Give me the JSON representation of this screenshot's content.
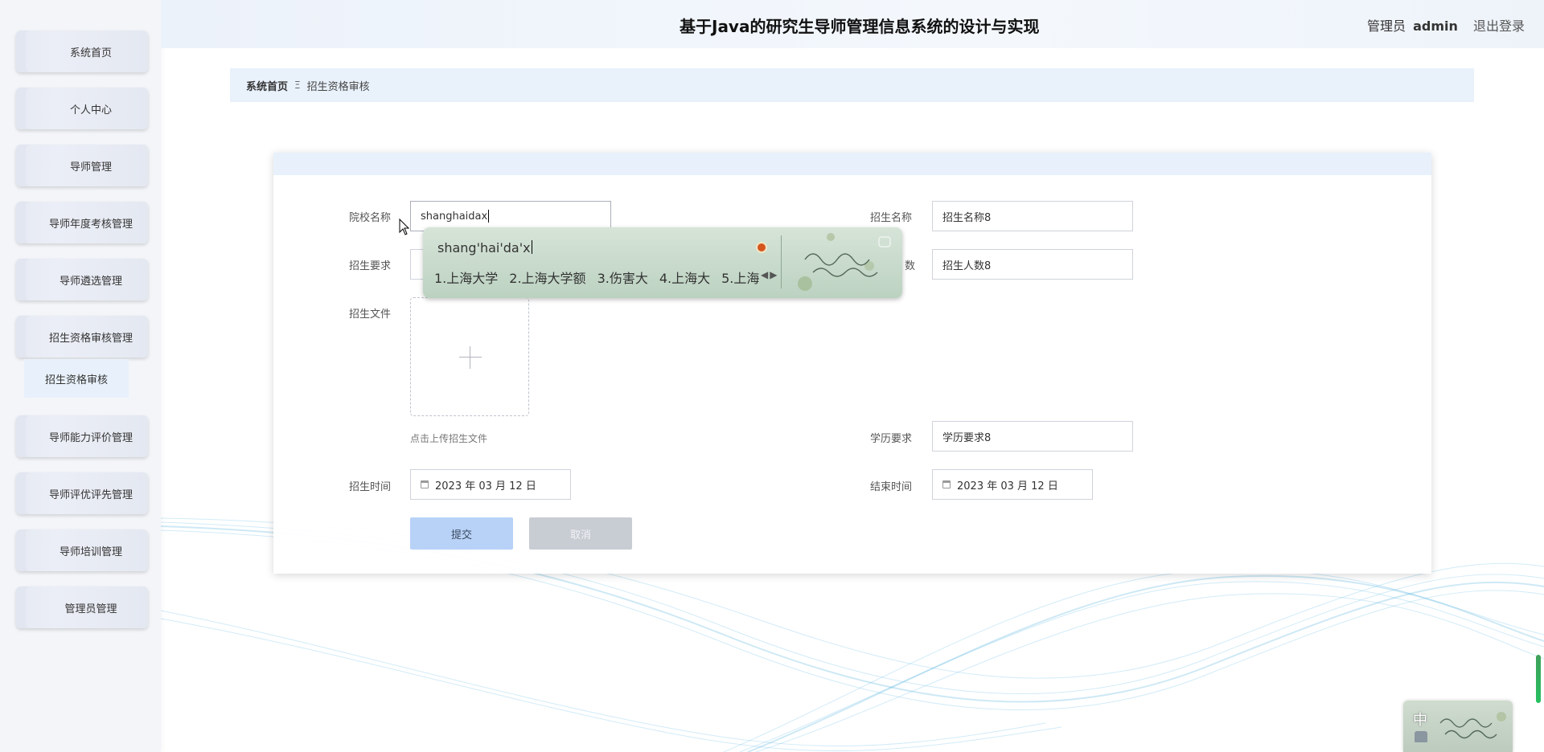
{
  "header": {
    "title": "基于Java的研究生导师管理信息系统的设计与实现",
    "user_role": "管理员",
    "user_name": "admin",
    "logout_label": "退出登录"
  },
  "sidebar": {
    "items": [
      {
        "label": "系统首页"
      },
      {
        "label": "个人中心"
      },
      {
        "label": "导师管理"
      },
      {
        "label": "导师年度考核管理"
      },
      {
        "label": "导师遴选管理"
      },
      {
        "label": "招生资格审核管理"
      },
      {
        "label": "导师能力评价管理"
      },
      {
        "label": "导师评优评先管理"
      },
      {
        "label": "导师培训管理"
      },
      {
        "label": "管理员管理"
      }
    ],
    "submenu": {
      "label": "招生资格审核"
    }
  },
  "breadcrumb": {
    "home": "系统首页",
    "separator": "Ξ",
    "current": "招生资格审核"
  },
  "form": {
    "school_name": {
      "label": "院校名称",
      "value": "shanghaidax"
    },
    "enroll_name": {
      "label": "招生名称",
      "value": "招生名称8"
    },
    "enroll_requirement": {
      "label": "招生要求",
      "value": ""
    },
    "enroll_count": {
      "label": "招生人数",
      "visible_label": "数",
      "value": "招生人数8"
    },
    "enroll_file": {
      "label": "招生文件",
      "hint": "点击上传招生文件"
    },
    "education_requirement": {
      "label": "学历要求",
      "value": "学历要求8"
    },
    "start_time": {
      "label": "招生时间",
      "value": "2023 年 03 月 12 日"
    },
    "end_time": {
      "label": "结束时间",
      "value": "2023 年 03 月 12 日"
    },
    "submit_label": "提交",
    "cancel_label": "取消"
  },
  "ime": {
    "composition": "shang'hai'da'x",
    "candidates": [
      "1.上海大学",
      "2.上海大学额",
      "3.伤害大",
      "4.上海大",
      "5.上海"
    ],
    "mode": "中"
  },
  "colors": {
    "submit_bg": "#b8d2f7",
    "cancel_bg": "#c8ccd3",
    "breadcrumb_bg": "#e9f1fb",
    "submenu_bg": "#e8f1fb"
  }
}
